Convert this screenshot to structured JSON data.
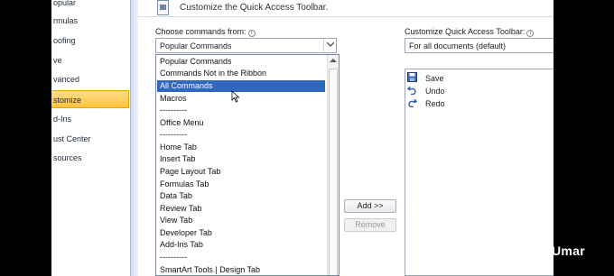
{
  "sidebar": {
    "items": [
      {
        "label": "opular",
        "active": false
      },
      {
        "label": "rmulas",
        "active": false
      },
      {
        "label": "oofing",
        "active": false
      },
      {
        "label": "ve",
        "active": false
      },
      {
        "label": "vanced",
        "active": false
      },
      {
        "label": "stomize",
        "active": true
      },
      {
        "label": "d-Ins",
        "active": false
      },
      {
        "label": "ust Center",
        "active": false
      },
      {
        "label": "sources",
        "active": false
      }
    ]
  },
  "header": {
    "title": "Customize the Quick Access Toolbar."
  },
  "choose": {
    "label": "Choose commands from:",
    "value": "Popular Commands"
  },
  "customize": {
    "label": "Customize Quick Access Toolbar:",
    "value": "For all documents (default)"
  },
  "dropdown": {
    "items": [
      {
        "label": "Popular Commands",
        "selected": false
      },
      {
        "label": "Commands Not in the Ribbon",
        "selected": false
      },
      {
        "label": "All Commands",
        "selected": true
      },
      {
        "label": "Macros",
        "selected": false
      },
      {
        "label": "----------",
        "selected": false
      },
      {
        "label": "Office Menu",
        "selected": false
      },
      {
        "label": "----------",
        "selected": false
      },
      {
        "label": "Home Tab",
        "selected": false
      },
      {
        "label": "Insert Tab",
        "selected": false
      },
      {
        "label": "Page Layout Tab",
        "selected": false
      },
      {
        "label": "Formulas Tab",
        "selected": false
      },
      {
        "label": "Data Tab",
        "selected": false
      },
      {
        "label": "Review Tab",
        "selected": false
      },
      {
        "label": "View Tab",
        "selected": false
      },
      {
        "label": "Developer Tab",
        "selected": false
      },
      {
        "label": "Add-Ins Tab",
        "selected": false
      },
      {
        "label": "----------",
        "selected": false
      },
      {
        "label": "SmartArt Tools | Design Tab",
        "selected": false
      }
    ]
  },
  "buttons": {
    "add": "Add >>",
    "remove": "Remove"
  },
  "qat": {
    "items": [
      {
        "label": "Save",
        "icon": "save-icon"
      },
      {
        "label": "Undo",
        "icon": "undo-icon"
      },
      {
        "label": "Redo",
        "icon": "redo-icon"
      }
    ]
  },
  "watermark": "Umar",
  "colors": {
    "selection": "#3166c1",
    "active_nav": "#ffc43d"
  }
}
